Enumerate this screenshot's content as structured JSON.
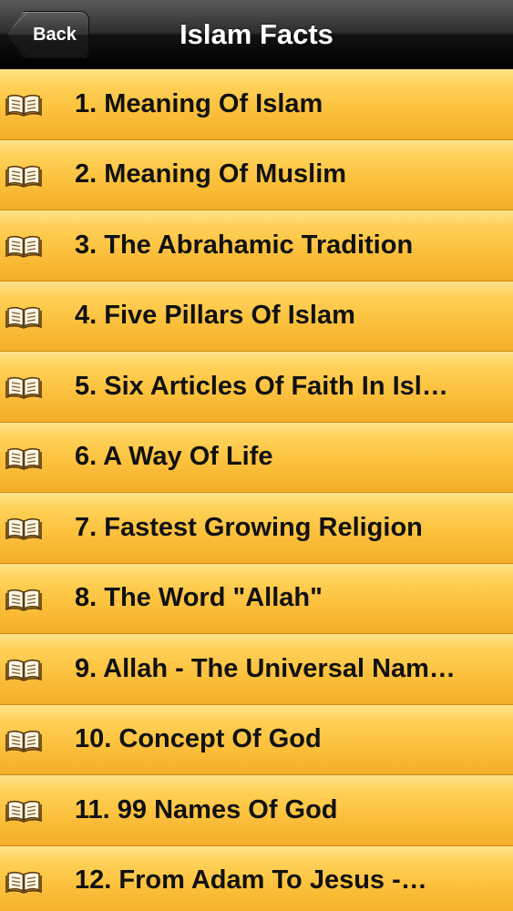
{
  "navbar": {
    "back_label": "Back",
    "title": "Islam Facts"
  },
  "list": {
    "icon": "open-book-icon",
    "items": [
      {
        "label": "1. Meaning Of Islam"
      },
      {
        "label": "2. Meaning Of Muslim"
      },
      {
        "label": "3. The Abrahamic Tradition"
      },
      {
        "label": "4. Five Pillars Of Islam"
      },
      {
        "label": "5. Six Articles Of Faith In Isl…"
      },
      {
        "label": "6. A Way Of Life"
      },
      {
        "label": "7. Fastest Growing Religion"
      },
      {
        "label": "8. The Word \"Allah\""
      },
      {
        "label": "9. Allah - The Universal Nam…"
      },
      {
        "label": "10. Concept Of God"
      },
      {
        "label": "11. 99 Names Of God"
      },
      {
        "label": "12. From Adam To Jesus -…"
      }
    ]
  },
  "colors": {
    "row_top": "#ffe38a",
    "row_bottom": "#f4ae29",
    "row_divider": "#c98a16",
    "navbar": "#000000",
    "text": "#111111"
  }
}
